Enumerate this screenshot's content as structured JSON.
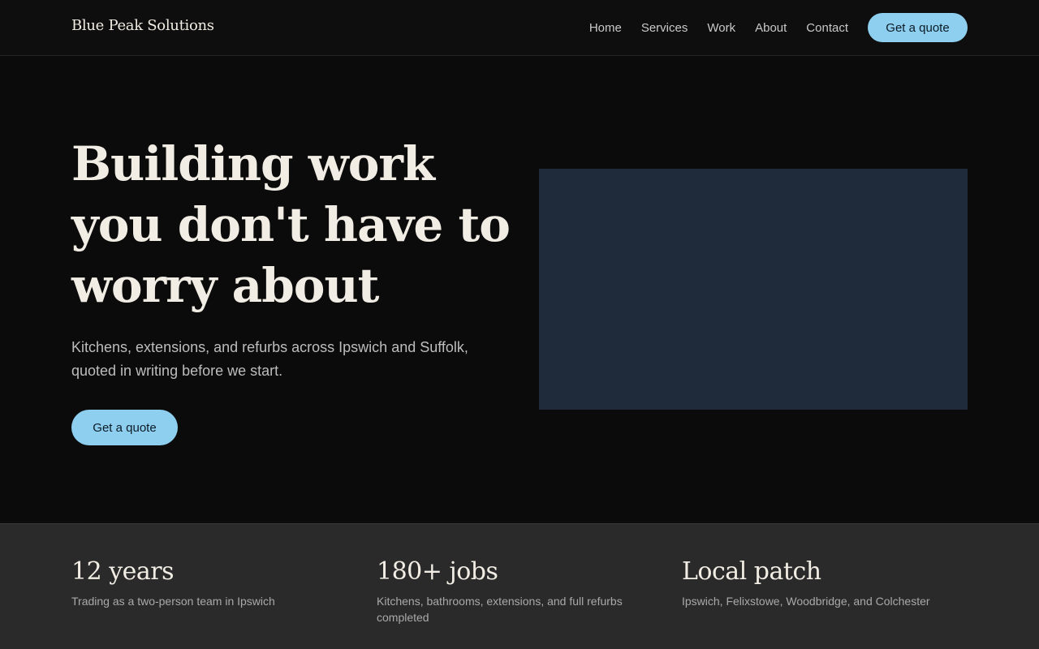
{
  "header": {
    "brand": "Blue Peak Solutions",
    "nav": [
      {
        "label": "Home"
      },
      {
        "label": "Services"
      },
      {
        "label": "Work"
      },
      {
        "label": "About"
      },
      {
        "label": "Contact"
      }
    ],
    "cta_label": "Get a quote"
  },
  "hero": {
    "headline": "Building work you don't have to worry about",
    "subtext": "Kitchens, extensions, and refurbs across Ipswich and Suffolk, quoted in writing before we start.",
    "cta_label": "Get a quote"
  },
  "stats": [
    {
      "value": "12 years",
      "desc": "Trading as a two-person team in Ipswich"
    },
    {
      "value": "180+ jobs",
      "desc": "Kitchens, bathrooms, extensions, and full refurbs completed"
    },
    {
      "value": "Local patch",
      "desc": "Ipswich, Felixstowe, Woodbridge, and Colchester"
    }
  ],
  "colors": {
    "accent": "#8ecff0",
    "background": "#0b0b0b",
    "stats_band": "#2a2a2a",
    "image_placeholder": "#1f2a3b",
    "heading_text": "#f2ede4"
  }
}
